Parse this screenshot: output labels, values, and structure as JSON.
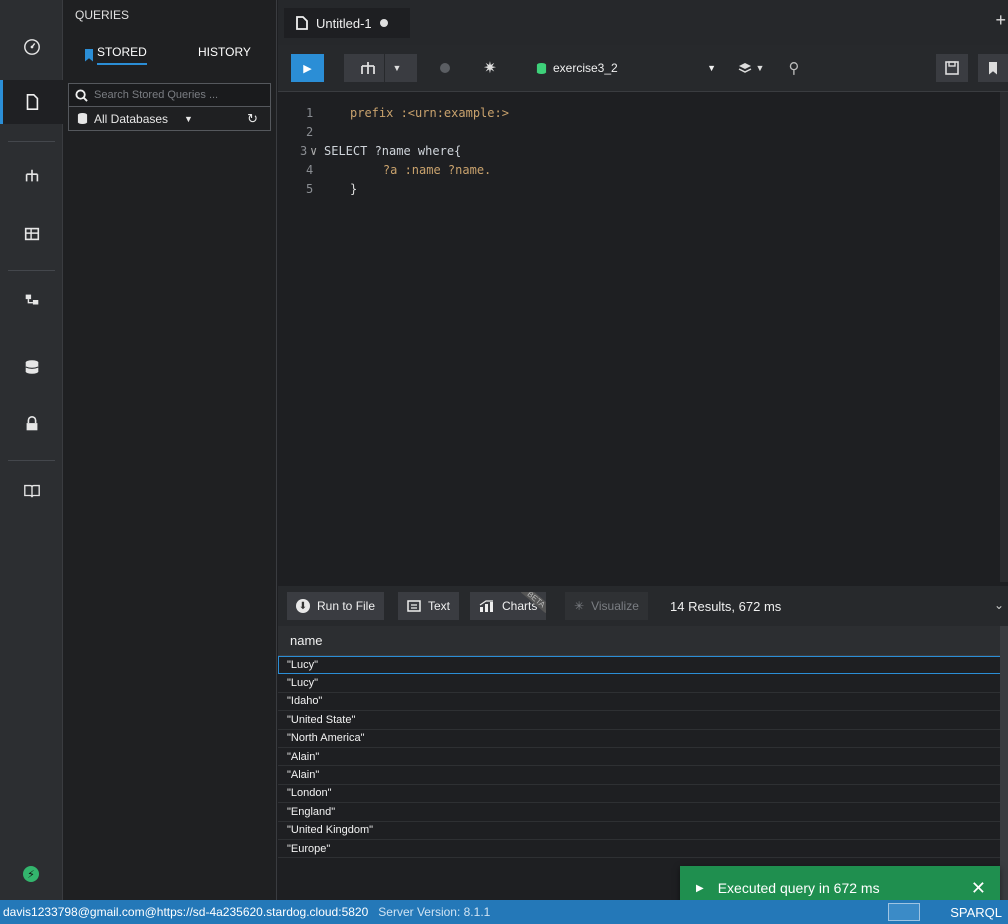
{
  "queries_panel": {
    "title": "QUERIES",
    "tab_stored": "STORED",
    "tab_history": "HISTORY",
    "search_placeholder": "Search Stored Queries ...",
    "database_filter": "All Databases"
  },
  "editor_tab": {
    "name": "Untitled-1"
  },
  "toolbar": {
    "database": "exercise3_2"
  },
  "code_lines": [
    {
      "num": "1",
      "text": "prefix :<urn:example:>"
    },
    {
      "num": "2",
      "text": ""
    },
    {
      "num": "3",
      "text": "SELECT ?name where{"
    },
    {
      "num": "4",
      "text": "    ?a :name ?name."
    },
    {
      "num": "5",
      "text": "}"
    }
  ],
  "results_bar": {
    "run_to_file": "Run to File",
    "text": "Text",
    "charts": "Charts",
    "beta": "BETA",
    "visualize": "Visualize",
    "summary": "14 Results,  672 ms"
  },
  "results_table": {
    "column": "name",
    "rows": [
      "\"Lucy\"",
      "\"Lucy\"",
      "\"Idaho\"",
      "\"United State\"",
      "\"North America\"",
      "\"Alain\"",
      "\"Alain\"",
      "\"London\"",
      "\"England\"",
      "\"United Kingdom\"",
      "\"Europe\""
    ]
  },
  "toast": {
    "message": "Executed query in 672 ms"
  },
  "status_bar": {
    "connection": "davis1233798@gmail.com@https://sd-4a235620.stardog.cloud:5820",
    "server_version": "Server Version: 8.1.1",
    "language": "SPARQL"
  },
  "colors": {
    "accent": "#2b8ed6",
    "toast": "#1f8f4f",
    "status": "#2478b8"
  }
}
